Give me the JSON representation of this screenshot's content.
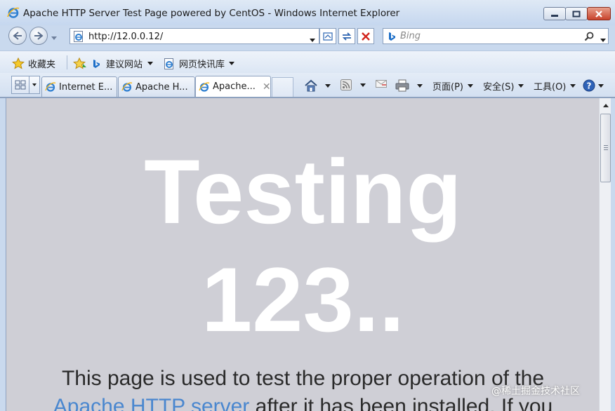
{
  "window": {
    "title": "Apache HTTP Server Test Page powered by CentOS - Windows Internet Explorer",
    "controls": [
      "minimize",
      "maximize",
      "close"
    ]
  },
  "navigation": {
    "address": "http://12.0.0.12/",
    "search_placeholder": "Bing"
  },
  "favorites_bar": {
    "favorites_label": "收藏夹",
    "suggested_sites": "建议网站",
    "web_slice_gallery": "网页快讯库"
  },
  "tabs": [
    {
      "label": "Internet E...",
      "active": false
    },
    {
      "label": "Apache H...",
      "active": false
    },
    {
      "label": "Apache...",
      "active": true
    }
  ],
  "command_bar": {
    "page": "页面(P)",
    "safety": "安全(S)",
    "tools": "工具(O)"
  },
  "content": {
    "hero_line1": "Testing",
    "hero_line2": "123..",
    "para_line1": "This page is used to test the proper operation of the",
    "para_link": "Apache HTTP server",
    "para_line2_rest": " after it has been installed. If you"
  },
  "watermark": "@稀土掘金技术社区",
  "colors": {
    "chrome": "#c9d9ee",
    "content_bg": "#cfcfd6",
    "hero_text": "#ffffff",
    "link": "#4a87cf"
  }
}
